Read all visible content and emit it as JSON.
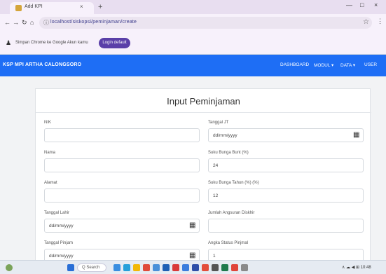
{
  "browser": {
    "tab_title": "Add KPI",
    "tab_close": "×",
    "new_tab": "+",
    "window_controls": [
      "—",
      "□",
      "×"
    ],
    "nav": [
      "←",
      "→",
      "↻",
      "⌂"
    ],
    "url": "localhost/siskopsi/peminjaman/create",
    "infobar_text": "Simpan Chrome ke Google Akun kamu",
    "infobar_button": "Login default"
  },
  "navbar": {
    "brand": "KSP MPI ARTHA CALONGSORO",
    "links": [
      "DASHBOARD",
      "MODUL ▾",
      "DATA ▾",
      "USER"
    ]
  },
  "form": {
    "title": "Input Peminjaman",
    "fields_left": [
      {
        "label": "NIK",
        "value": ""
      },
      {
        "label": "Nama",
        "value": ""
      },
      {
        "label": "Alamat",
        "value": ""
      },
      {
        "label": "Tanggal Lahir",
        "value": "dd/mm/yyyy"
      },
      {
        "label": "Tanggal Pinjam",
        "value": "dd/mm/yyyy"
      }
    ],
    "fields_right": [
      {
        "label": "Tanggal JT",
        "value": "dd/mm/yyyy"
      },
      {
        "label": "Suku Bunga Bunt (%)",
        "value": "24"
      },
      {
        "label": "Suku Bunga Tahun (%) (%)",
        "value": "12"
      },
      {
        "label": "Jumlah Angsuran Diskhir",
        "value": ""
      },
      {
        "label": "Angka Status Pinjmal",
        "value": "1"
      }
    ]
  },
  "taskbar": {
    "search_text": "Q Search",
    "tray": "∧ ☁ ◀ ⊞ 10:48"
  }
}
